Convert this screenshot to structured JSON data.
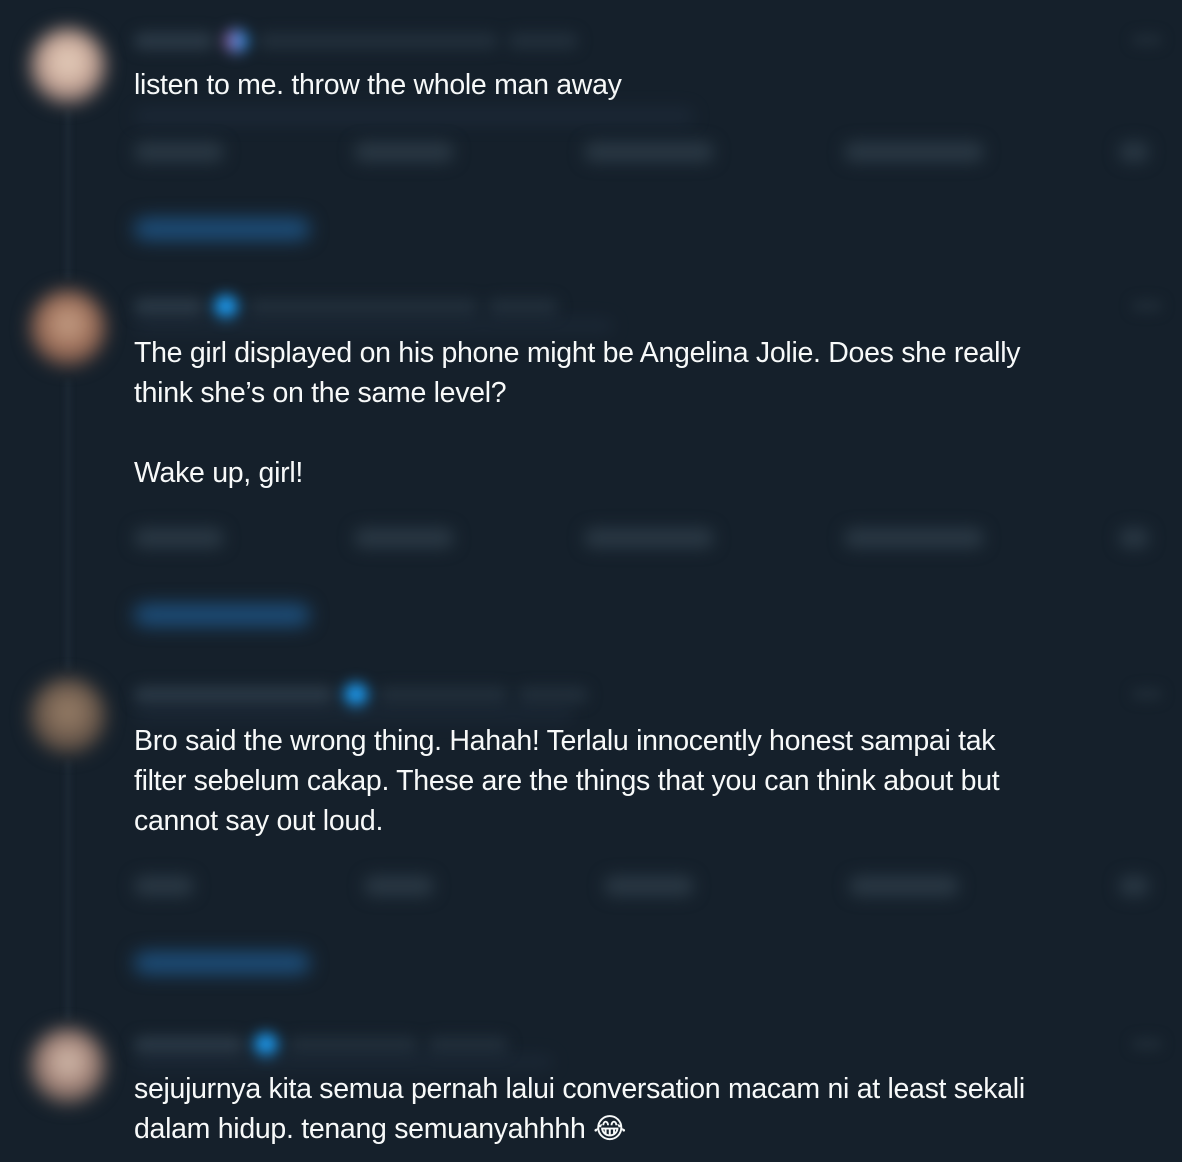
{
  "posts": [
    {
      "text": "listen to me. throw the whole man away"
    },
    {
      "text": "The girl displayed on his phone might be Angelina Jolie. Does she really\nthink she’s on the same level?\n\nWake up, girl!"
    },
    {
      "text": "Bro said the wrong thing. Hahah! Terlalu innocently honest sampai tak\nfilter sebelum cakap. These are the things that you can think about but\ncannot say out loud."
    },
    {
      "text": "sejujurnya kita semua pernah lalui conversation macam ni at least sekali\ndalam hidup. tenang semuanyahhhh",
      "emoji": "😂"
    }
  ],
  "colors": {
    "background": "#15202b",
    "text": "#f7f9f9",
    "accent": "#1d9bf0"
  },
  "icons": [
    "verified-badge-icon",
    "reply-icon",
    "retweet-icon",
    "like-icon",
    "views-icon",
    "share-icon",
    "more-icon"
  ]
}
